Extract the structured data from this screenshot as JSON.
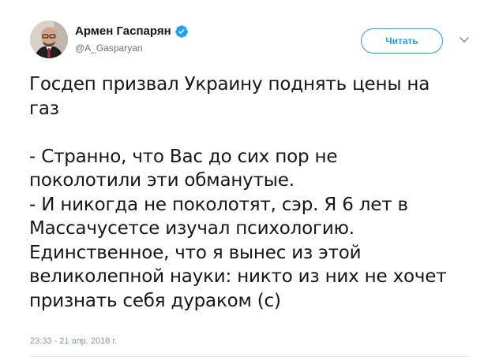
{
  "author": {
    "name": "Армен Гаспарян",
    "handle": "@A_Gasparyan",
    "verified": true
  },
  "follow_button": {
    "label": "Читать"
  },
  "tweet": {
    "lines": [
      "Госдеп призвал Украину поднять цены на",
      "газ",
      "",
      "- Странно, что Вас до сих пор не",
      "поколотили эти обманутые.",
      "- И никогда не поколотят, сэр. Я 6 лет в",
      "Массачусетсе изучал психологию.",
      "Единственное, что я вынес из этой",
      "великолепной науки: никто из них не хочет",
      "признать себя дураком (с)"
    ],
    "timestamp": "23:33 - 21 апр. 2018 г."
  },
  "icons": {
    "verified": "verified-badge-icon",
    "caret": "chevron-down-icon"
  },
  "colors": {
    "accent": "#1da1f2",
    "text": "#14171a",
    "secondary": "#657786",
    "timestamp": "#8899a6"
  }
}
